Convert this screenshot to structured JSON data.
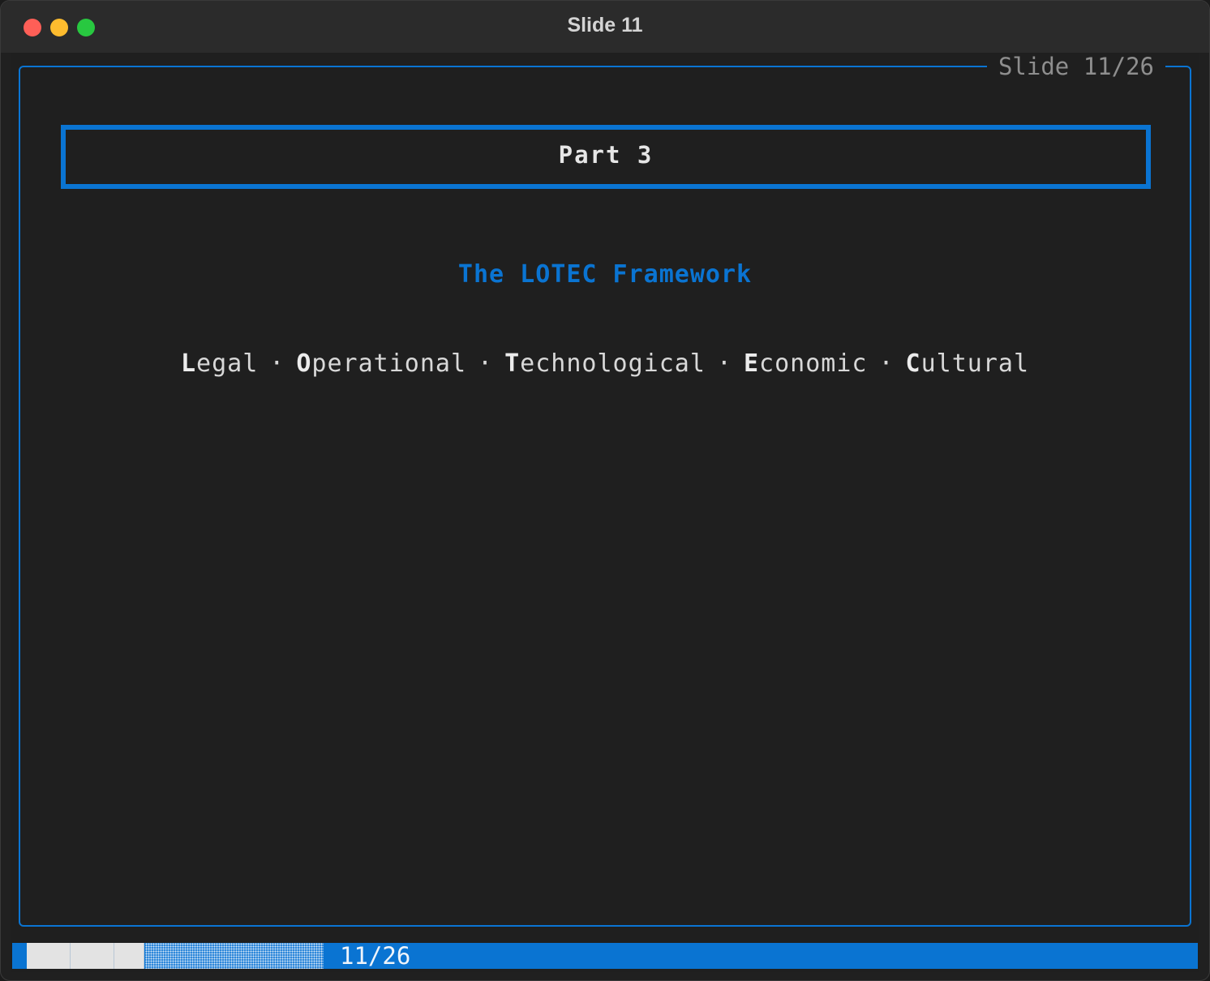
{
  "window": {
    "title": "Slide 11"
  },
  "slide": {
    "counter": "Slide 11/26",
    "part_title": "Part 3",
    "subtitle": "The LOTEC Framework",
    "framework_items": [
      {
        "initial": "L",
        "rest": "egal"
      },
      {
        "initial": "O",
        "rest": "perational"
      },
      {
        "initial": "T",
        "rest": "echnological"
      },
      {
        "initial": "E",
        "rest": "conomic"
      },
      {
        "initial": "C",
        "rest": "ultural"
      }
    ],
    "separator": "·"
  },
  "status": {
    "progress_text": "11/26",
    "progress_fraction": 0.4231
  },
  "colors": {
    "accent": "#0a74d2",
    "background": "#1f1f1f",
    "text": "#e6e6e6"
  }
}
